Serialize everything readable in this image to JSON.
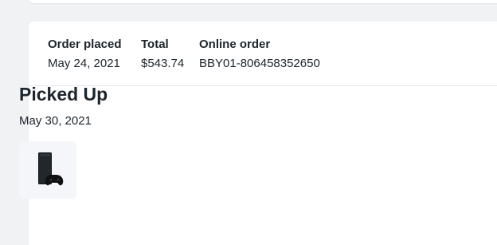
{
  "order": {
    "placed_label": "Order placed",
    "placed_value": "May 24, 2021",
    "total_label": "Total",
    "total_value": "$543.74",
    "online_label": "Online order",
    "online_value": "BBY01-806458352650"
  },
  "status": {
    "title": "Picked Up",
    "date": "May 30, 2021"
  },
  "product": {
    "icon": "game-console-icon"
  }
}
